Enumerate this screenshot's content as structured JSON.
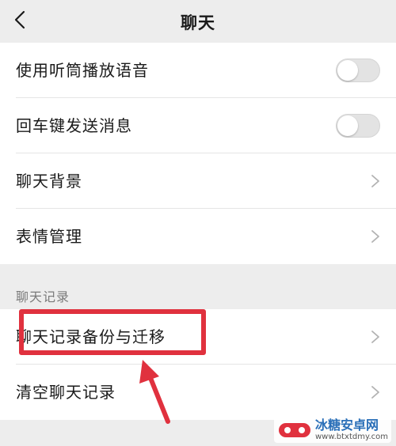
{
  "header": {
    "title": "聊天"
  },
  "group1": [
    {
      "label": "使用听筒播放语音",
      "control": "toggle",
      "on": false
    },
    {
      "label": "回车键发送消息",
      "control": "toggle",
      "on": false
    },
    {
      "label": "聊天背景",
      "control": "chevron"
    },
    {
      "label": "表情管理",
      "control": "chevron"
    }
  ],
  "section": {
    "title": "聊天记录"
  },
  "group2": [
    {
      "label": "聊天记录备份与迁移",
      "control": "chevron"
    },
    {
      "label": "清空聊天记录",
      "control": "chevron"
    }
  ],
  "colors": {
    "highlight": "#e0313e",
    "background": "#ededed"
  },
  "watermark": {
    "name": "冰糖安卓网",
    "url": "www.btxtdmy.com"
  }
}
